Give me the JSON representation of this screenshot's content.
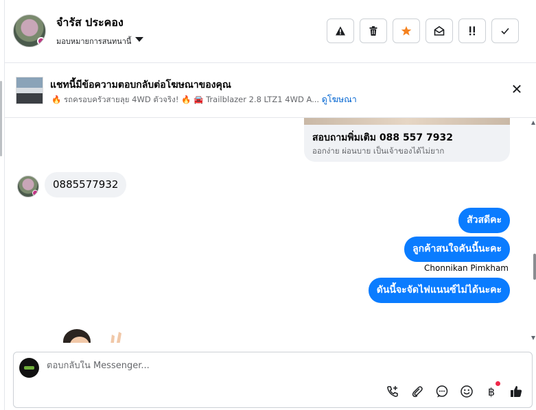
{
  "header": {
    "contact_name": "จำรัส ประคอง",
    "assign_label": "มอบหมายการสนทนานี้",
    "actions": [
      {
        "name": "report-button",
        "icon": "warning-icon"
      },
      {
        "name": "delete-button",
        "icon": "trash-icon"
      },
      {
        "name": "star-button",
        "icon": "star-icon"
      },
      {
        "name": "mark-unread-button",
        "icon": "envelope-open-icon"
      },
      {
        "name": "follow-up-button",
        "icon": "exclamation-icon"
      },
      {
        "name": "done-button",
        "icon": "check-icon"
      }
    ]
  },
  "banner": {
    "title": "แชทนี้มีข้อความตอบกลับต่อโฆษณาของคุณ",
    "ad_text": "รถครอบครัวสายลุย 4WD ตัวจริง!",
    "car_text": "Trailblazer 2.8 LTZ1 4WD A...",
    "link": "ดูโฆษณา"
  },
  "chat": {
    "card_title": "สอบถามพิ่มเติม 088 557 7932",
    "card_sub": "ออกง่าย ผ่อนบาย เป็นเจ้าของได้ไม่ยาก",
    "incoming_message": "0885577932",
    "outgoing": [
      "สัวสดีคะ",
      "ลูกค้าสนใจคันนี้นะคะ",
      "ดันนี้จะจัดไฟแนนซ์ไม่ได้นะคะ"
    ],
    "sender_name": "Chonnikan Pimkham"
  },
  "composer": {
    "placeholder": "ตอบกลับใน Messenger...",
    "tools": [
      "call-plus-icon",
      "paperclip-icon",
      "chat-bubble-icon",
      "smiley-icon",
      "baht-icon",
      "thumbs-up-icon"
    ]
  },
  "colors": {
    "accent": "#0a7cff",
    "star": "#f5821f",
    "notify": "#f02849"
  }
}
